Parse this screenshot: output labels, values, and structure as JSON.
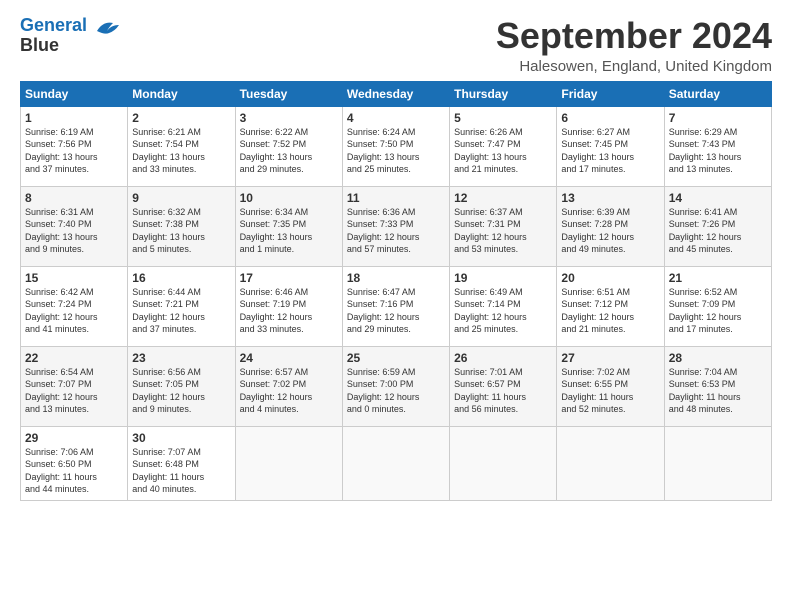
{
  "header": {
    "logo_line1": "General",
    "logo_line2": "Blue",
    "title": "September 2024",
    "location": "Halesowen, England, United Kingdom"
  },
  "weekdays": [
    "Sunday",
    "Monday",
    "Tuesday",
    "Wednesday",
    "Thursday",
    "Friday",
    "Saturday"
  ],
  "weeks": [
    [
      {
        "day": "1",
        "info": "Sunrise: 6:19 AM\nSunset: 7:56 PM\nDaylight: 13 hours\nand 37 minutes."
      },
      {
        "day": "2",
        "info": "Sunrise: 6:21 AM\nSunset: 7:54 PM\nDaylight: 13 hours\nand 33 minutes."
      },
      {
        "day": "3",
        "info": "Sunrise: 6:22 AM\nSunset: 7:52 PM\nDaylight: 13 hours\nand 29 minutes."
      },
      {
        "day": "4",
        "info": "Sunrise: 6:24 AM\nSunset: 7:50 PM\nDaylight: 13 hours\nand 25 minutes."
      },
      {
        "day": "5",
        "info": "Sunrise: 6:26 AM\nSunset: 7:47 PM\nDaylight: 13 hours\nand 21 minutes."
      },
      {
        "day": "6",
        "info": "Sunrise: 6:27 AM\nSunset: 7:45 PM\nDaylight: 13 hours\nand 17 minutes."
      },
      {
        "day": "7",
        "info": "Sunrise: 6:29 AM\nSunset: 7:43 PM\nDaylight: 13 hours\nand 13 minutes."
      }
    ],
    [
      {
        "day": "8",
        "info": "Sunrise: 6:31 AM\nSunset: 7:40 PM\nDaylight: 13 hours\nand 9 minutes."
      },
      {
        "day": "9",
        "info": "Sunrise: 6:32 AM\nSunset: 7:38 PM\nDaylight: 13 hours\nand 5 minutes."
      },
      {
        "day": "10",
        "info": "Sunrise: 6:34 AM\nSunset: 7:35 PM\nDaylight: 13 hours\nand 1 minute."
      },
      {
        "day": "11",
        "info": "Sunrise: 6:36 AM\nSunset: 7:33 PM\nDaylight: 12 hours\nand 57 minutes."
      },
      {
        "day": "12",
        "info": "Sunrise: 6:37 AM\nSunset: 7:31 PM\nDaylight: 12 hours\nand 53 minutes."
      },
      {
        "day": "13",
        "info": "Sunrise: 6:39 AM\nSunset: 7:28 PM\nDaylight: 12 hours\nand 49 minutes."
      },
      {
        "day": "14",
        "info": "Sunrise: 6:41 AM\nSunset: 7:26 PM\nDaylight: 12 hours\nand 45 minutes."
      }
    ],
    [
      {
        "day": "15",
        "info": "Sunrise: 6:42 AM\nSunset: 7:24 PM\nDaylight: 12 hours\nand 41 minutes."
      },
      {
        "day": "16",
        "info": "Sunrise: 6:44 AM\nSunset: 7:21 PM\nDaylight: 12 hours\nand 37 minutes."
      },
      {
        "day": "17",
        "info": "Sunrise: 6:46 AM\nSunset: 7:19 PM\nDaylight: 12 hours\nand 33 minutes."
      },
      {
        "day": "18",
        "info": "Sunrise: 6:47 AM\nSunset: 7:16 PM\nDaylight: 12 hours\nand 29 minutes."
      },
      {
        "day": "19",
        "info": "Sunrise: 6:49 AM\nSunset: 7:14 PM\nDaylight: 12 hours\nand 25 minutes."
      },
      {
        "day": "20",
        "info": "Sunrise: 6:51 AM\nSunset: 7:12 PM\nDaylight: 12 hours\nand 21 minutes."
      },
      {
        "day": "21",
        "info": "Sunrise: 6:52 AM\nSunset: 7:09 PM\nDaylight: 12 hours\nand 17 minutes."
      }
    ],
    [
      {
        "day": "22",
        "info": "Sunrise: 6:54 AM\nSunset: 7:07 PM\nDaylight: 12 hours\nand 13 minutes."
      },
      {
        "day": "23",
        "info": "Sunrise: 6:56 AM\nSunset: 7:05 PM\nDaylight: 12 hours\nand 9 minutes."
      },
      {
        "day": "24",
        "info": "Sunrise: 6:57 AM\nSunset: 7:02 PM\nDaylight: 12 hours\nand 4 minutes."
      },
      {
        "day": "25",
        "info": "Sunrise: 6:59 AM\nSunset: 7:00 PM\nDaylight: 12 hours\nand 0 minutes."
      },
      {
        "day": "26",
        "info": "Sunrise: 7:01 AM\nSunset: 6:57 PM\nDaylight: 11 hours\nand 56 minutes."
      },
      {
        "day": "27",
        "info": "Sunrise: 7:02 AM\nSunset: 6:55 PM\nDaylight: 11 hours\nand 52 minutes."
      },
      {
        "day": "28",
        "info": "Sunrise: 7:04 AM\nSunset: 6:53 PM\nDaylight: 11 hours\nand 48 minutes."
      }
    ],
    [
      {
        "day": "29",
        "info": "Sunrise: 7:06 AM\nSunset: 6:50 PM\nDaylight: 11 hours\nand 44 minutes."
      },
      {
        "day": "30",
        "info": "Sunrise: 7:07 AM\nSunset: 6:48 PM\nDaylight: 11 hours\nand 40 minutes."
      },
      {
        "day": "",
        "info": ""
      },
      {
        "day": "",
        "info": ""
      },
      {
        "day": "",
        "info": ""
      },
      {
        "day": "",
        "info": ""
      },
      {
        "day": "",
        "info": ""
      }
    ]
  ]
}
